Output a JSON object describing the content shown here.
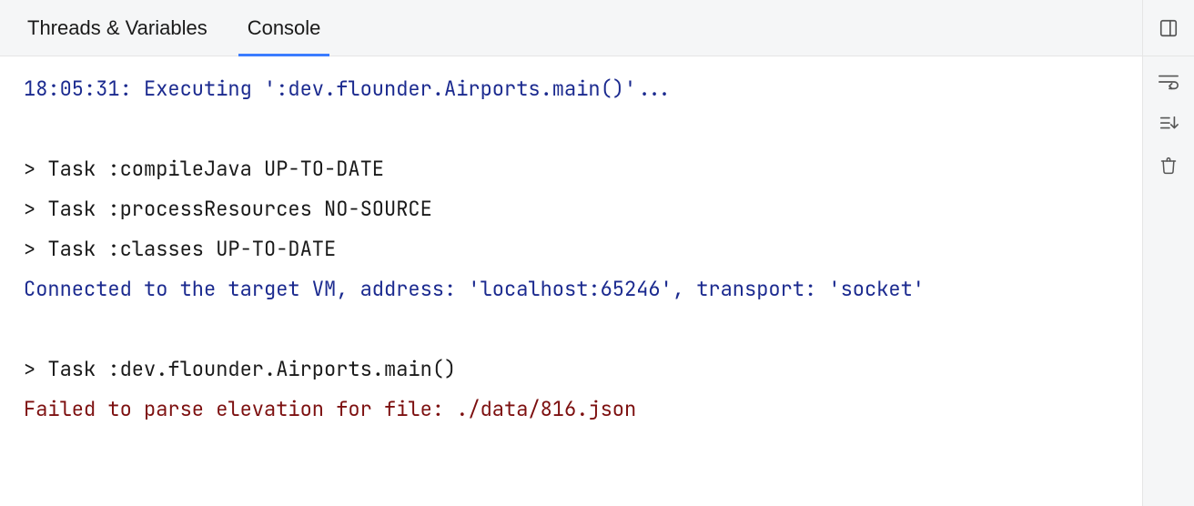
{
  "tabs": {
    "threads": "Threads & Variables",
    "console": "Console",
    "active": "console"
  },
  "console_lines": [
    {
      "class": "dark-blue",
      "text": "18:05:31: Executing ':dev.flounder.Airports.main()'..."
    },
    {
      "class": "",
      "text": ""
    },
    {
      "class": "",
      "text": "> Task :compileJava UP-TO-DATE"
    },
    {
      "class": "",
      "text": "> Task :processResources NO-SOURCE"
    },
    {
      "class": "",
      "text": "> Task :classes UP-TO-DATE"
    },
    {
      "class": "dark-blue",
      "text": "Connected to the target VM, address: 'localhost:65246', transport: 'socket'"
    },
    {
      "class": "",
      "text": ""
    },
    {
      "class": "",
      "text": "> Task :dev.flounder.Airports.main()"
    },
    {
      "class": "dark-red",
      "text": "Failed to parse elevation for file: ./data/816.json"
    }
  ],
  "rail": {
    "layout": "layout-icon",
    "soft_wrap": "soft-wrap-icon",
    "scroll_end": "scroll-to-end-icon",
    "clear": "clear-all-icon"
  }
}
